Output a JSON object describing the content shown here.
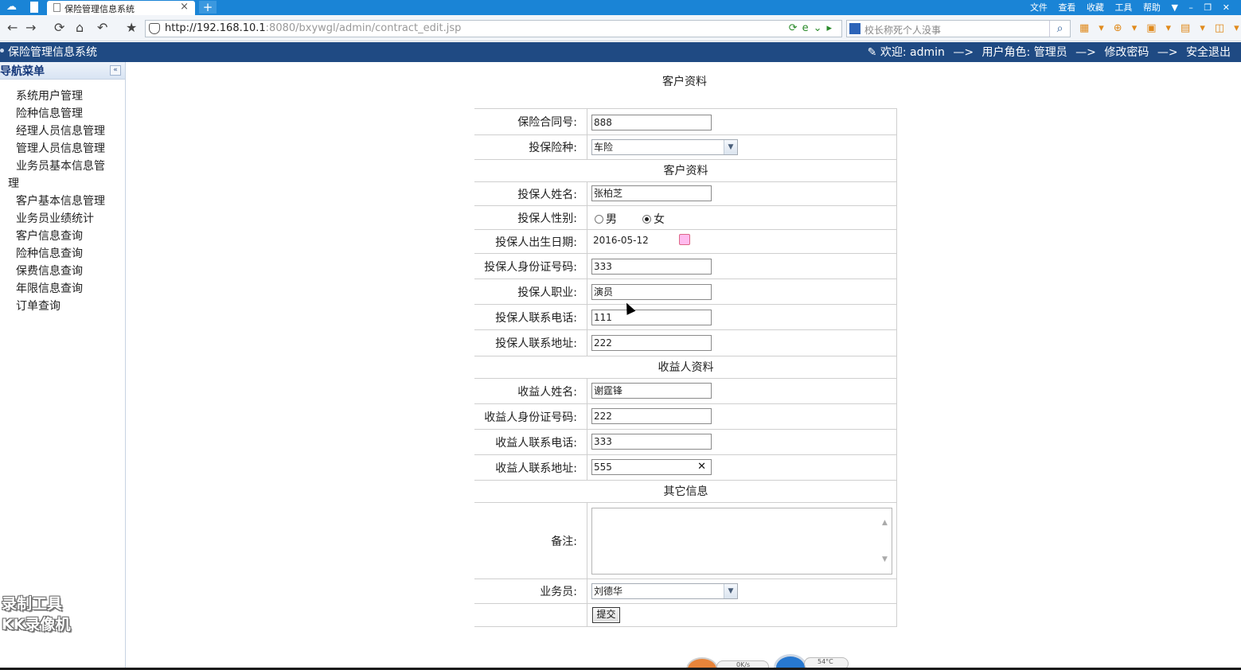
{
  "browser": {
    "tab_title": "保险管理信息系统",
    "tab_close": "×",
    "new_tab": "+",
    "menu": [
      "文件",
      "查看",
      "收藏",
      "工具",
      "帮助"
    ],
    "url_host": "http://192.168.10.1",
    "url_rest": ":8080/bxywgl/admin/contract_edit.jsp",
    "search_placeholder": "校长称死个人没事"
  },
  "header": {
    "title": "保险管理信息系统",
    "welcome": "欢迎: admin",
    "arrow": "—>",
    "role": "用户角色: 管理员",
    "change_password": "修改密码",
    "logout": "安全退出"
  },
  "sidebar": {
    "title": "导航菜单",
    "collapse": "«",
    "items": [
      {
        "label": "系统用户管理"
      },
      {
        "label": "险种信息管理"
      },
      {
        "label": "经理人员信息管理"
      },
      {
        "label": "管理人员信息管理"
      },
      {
        "label": "业务员基本信息管",
        "label2": "理"
      },
      {
        "label": "客户基本信息管理"
      },
      {
        "label": "业务员业绩统计"
      },
      {
        "label": "客户信息查询"
      },
      {
        "label": "险种信息查询"
      },
      {
        "label": "保费信息查询"
      },
      {
        "label": "年限信息查询"
      },
      {
        "label": "订单查询"
      }
    ]
  },
  "watermark": {
    "line1": "录制工具",
    "line2": "KK录像机"
  },
  "page": {
    "heading": "客户资料"
  },
  "form": {
    "contract_no": {
      "label": "保险合同号:",
      "value": "888"
    },
    "insurance_type": {
      "label": "投保险种:",
      "value": "车险"
    },
    "section_customer": "客户资料",
    "name": {
      "label": "投保人姓名:",
      "value": "张柏芝"
    },
    "gender": {
      "label": "投保人性别:",
      "male": "男",
      "female": "女",
      "selected": "女"
    },
    "birth": {
      "label": "投保人出生日期:",
      "value": "2016-05-12"
    },
    "id_no": {
      "label": "投保人身份证号码:",
      "value": "333"
    },
    "job": {
      "label": "投保人职业:",
      "value": "演员"
    },
    "phone": {
      "label": "投保人联系电话:",
      "value": "111"
    },
    "address": {
      "label": "投保人联系地址:",
      "value": "222"
    },
    "section_beneficiary": "收益人资料",
    "ben_name": {
      "label": "收益人姓名:",
      "value": "谢霆锋"
    },
    "ben_id": {
      "label": "收益人身份证号码:",
      "value": "222"
    },
    "ben_phone": {
      "label": "收益人联系电话:",
      "value": "333"
    },
    "ben_address": {
      "label": "收益人联系地址:",
      "value": "555"
    },
    "section_other": "其它信息",
    "remark": {
      "label": "备注:",
      "value": ""
    },
    "salesman": {
      "label": "业务员:",
      "value": "刘德华"
    },
    "submit": "提交"
  },
  "widgets": {
    "net": "0K/s",
    "temp": "54°C"
  }
}
